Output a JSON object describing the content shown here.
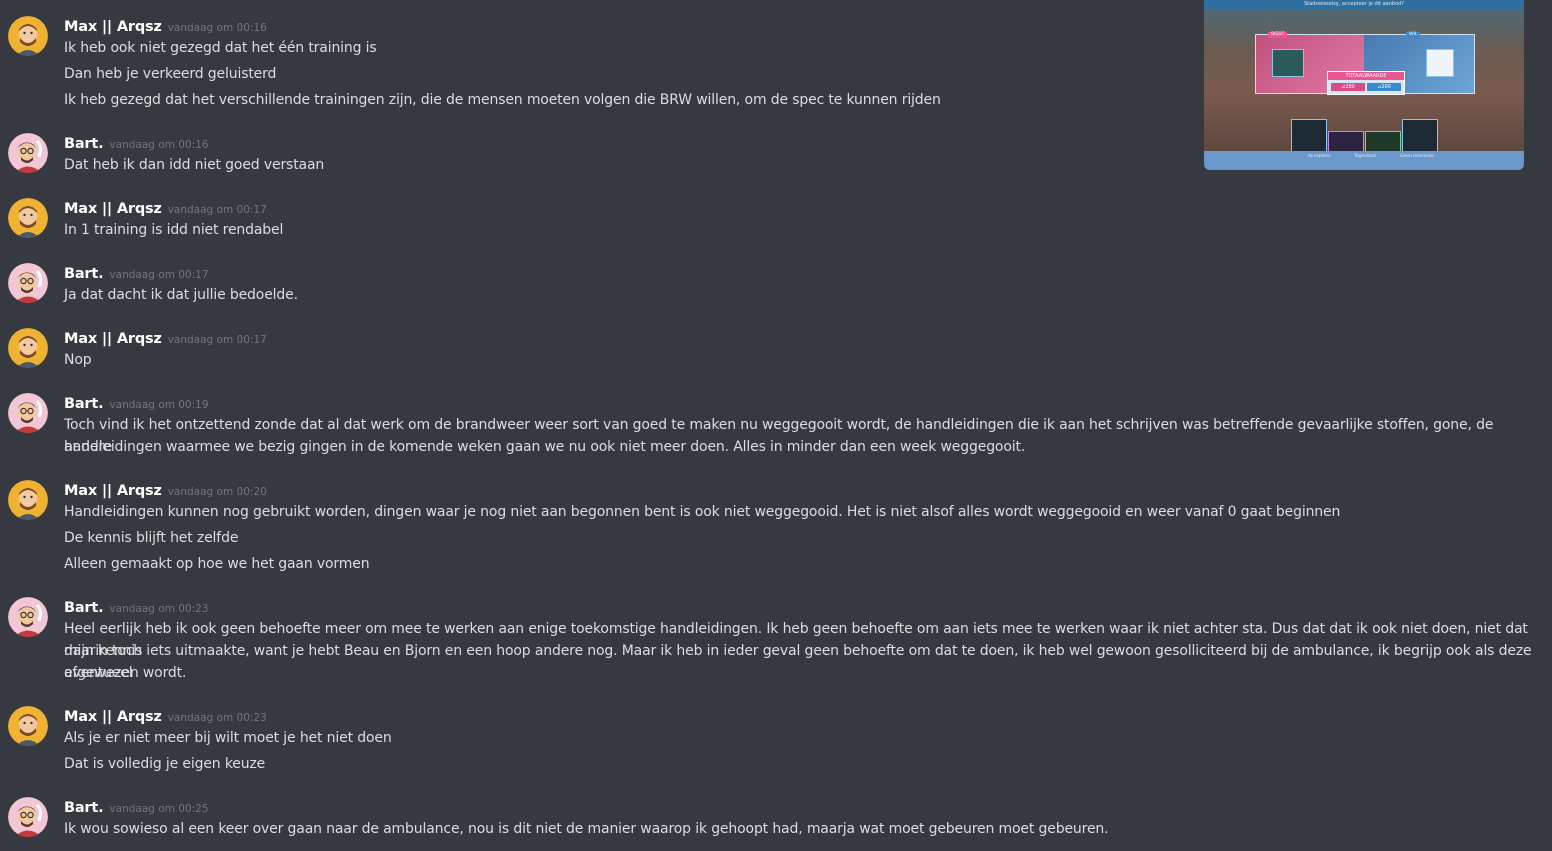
{
  "embed": {
    "top_bar_text": "Stadswisselsy, accepteer je dit aanbod?",
    "left_tag": "BIEDT",
    "right_tag": "WIL",
    "total_label": "TOTAALWAARDE",
    "total_left": "⊿280",
    "total_right": "⊿200",
    "bottom_items": [
      "Accepteer",
      "Tegenbod",
      "Geen interesse"
    ]
  },
  "users": {
    "max": {
      "name": "Max || Arqsz",
      "avatar_bg": "#f0b232"
    },
    "bart": {
      "name": "Bart.",
      "avatar_bg": "#f3c6d6"
    }
  },
  "messages": [
    {
      "author": "Max || Arqsz",
      "timestamp": "vandaag om 00:16",
      "lines": [
        "Ik heb ook niet gezegd dat het één training is",
        "Dan heb je verkeerd geluisterd",
        "Ik heb gezegd dat het verschillende trainingen zijn, die de mensen moeten volgen die BRW willen, om de spec te kunnen rijden"
      ]
    },
    {
      "author": "Bart.",
      "timestamp": "vandaag om 00:16",
      "lines": [
        "Dat heb ik dan idd niet goed verstaan"
      ]
    },
    {
      "author": "Max || Arqsz",
      "timestamp": "vandaag om 00:17",
      "lines": [
        "In 1 training is idd niet rendabel"
      ]
    },
    {
      "author": "Bart.",
      "timestamp": "vandaag om 00:17",
      "lines": [
        "Ja dat dacht ik dat jullie bedoelde."
      ]
    },
    {
      "author": "Max || Arqsz",
      "timestamp": "vandaag om 00:17",
      "lines": [
        "Nop"
      ]
    },
    {
      "author": "Bart.",
      "timestamp": "vandaag om 00:19",
      "lines": [
        "Toch vind ik het ontzettend zonde dat al dat werk om de brandweer weer sort van goed te maken nu weggegooit wordt, de handleidingen die ik aan het schrijven was betreffende gevaarlijke stoffen, gone, de andere",
        "handleidingen waarmee we bezig gingen in de komende weken gaan we nu ook niet meer doen. Alles in minder dan een week weggegooit."
      ]
    },
    {
      "author": "Max || Arqsz",
      "timestamp": "vandaag om 00:20",
      "lines": [
        "Handleidingen kunnen nog gebruikt worden, dingen waar je nog niet aan begonnen bent is ook niet weggegooid. Het is niet alsof alles wordt weggegooid en weer vanaf 0 gaat beginnen",
        "De kennis blijft het zelfde",
        "Alleen gemaakt op hoe we het gaan vormen"
      ]
    },
    {
      "author": "Bart.",
      "timestamp": "vandaag om 00:23",
      "lines": [
        "Heel eerlijk heb ik ook geen behoefte meer om mee te werken aan enige toekomstige handleidingen. Ik heb  geen behoefte om aan iets mee te werken waar ik niet achter sta. Dus dat dat ik ook niet doen, niet dat mijn kennis",
        "daarin toch iets uitmaakte, want je hebt Beau en Bjorn en een hoop andere nog. Maar ik heb in ieder geval geen behoefte om dat te doen, ik heb wel gewoon gesolliciteerd bij de ambulance, ik begrijp ook als deze eventueel",
        "afgewezen wordt."
      ]
    },
    {
      "author": "Max || Arqsz",
      "timestamp": "vandaag om 00:23",
      "lines": [
        "Als je er niet meer bij wilt moet je het niet doen",
        "Dat is volledig je eigen keuze"
      ]
    },
    {
      "author": "Bart.",
      "timestamp": "vandaag om 00:25",
      "lines": [
        "Ik wou sowieso al een keer over gaan naar de ambulance, nou is dit niet de manier waarop ik gehoopt had, maarja wat moet gebeuren moet gebeuren."
      ]
    }
  ]
}
